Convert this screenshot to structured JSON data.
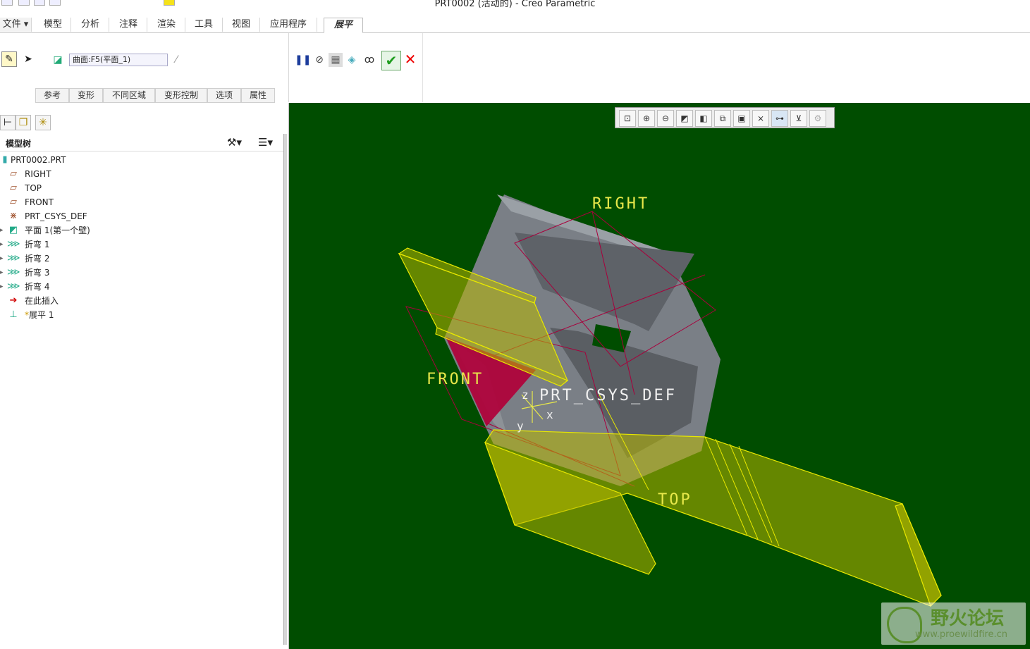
{
  "window": {
    "title": "PRT0002 (活动的) - Creo Parametric"
  },
  "menu": {
    "file": "文件",
    "tabs": [
      "模型",
      "分析",
      "注释",
      "渲染",
      "工具",
      "视图",
      "应用程序",
      "展平"
    ]
  },
  "ribbon": {
    "surface_field": "曲面:F5(平面_1)",
    "subtabs": [
      "参考",
      "变形",
      "不同区域",
      "变形控制",
      "选项",
      "属性"
    ]
  },
  "model_tree": {
    "title": "模型树",
    "items": [
      {
        "label": "PRT0002.PRT",
        "icon": "part-icon"
      },
      {
        "label": "RIGHT",
        "icon": "datum-plane-icon"
      },
      {
        "label": "TOP",
        "icon": "datum-plane-icon"
      },
      {
        "label": "FRONT",
        "icon": "datum-plane-icon"
      },
      {
        "label": "PRT_CSYS_DEF",
        "icon": "csys-icon"
      },
      {
        "label": "平面 1(第一个壁)",
        "icon": "wall-icon"
      },
      {
        "label": "折弯 1",
        "icon": "bend-icon"
      },
      {
        "label": "折弯 2",
        "icon": "bend-icon"
      },
      {
        "label": "折弯 3",
        "icon": "bend-icon"
      },
      {
        "label": "折弯 4",
        "icon": "bend-icon"
      },
      {
        "label": "在此插入",
        "icon": "insert-here-icon"
      },
      {
        "label": "展平 1",
        "icon": "flatten-icon"
      }
    ]
  },
  "viewport": {
    "labels": {
      "right": "RIGHT",
      "front": "FRONT",
      "top": "TOP",
      "csys": "PRT_CSYS_DEF",
      "axis_z": "z",
      "axis_x": "x",
      "axis_y": "y"
    },
    "background": "#004d00"
  },
  "watermark": {
    "title": "野火论坛",
    "url": "www.proewildfire.cn"
  },
  "colors": {
    "datum_label": "#e8e84a",
    "flat_pattern": "#c8c800",
    "selected_surface": "#b0003a",
    "part_gray": "#7a7f86"
  }
}
